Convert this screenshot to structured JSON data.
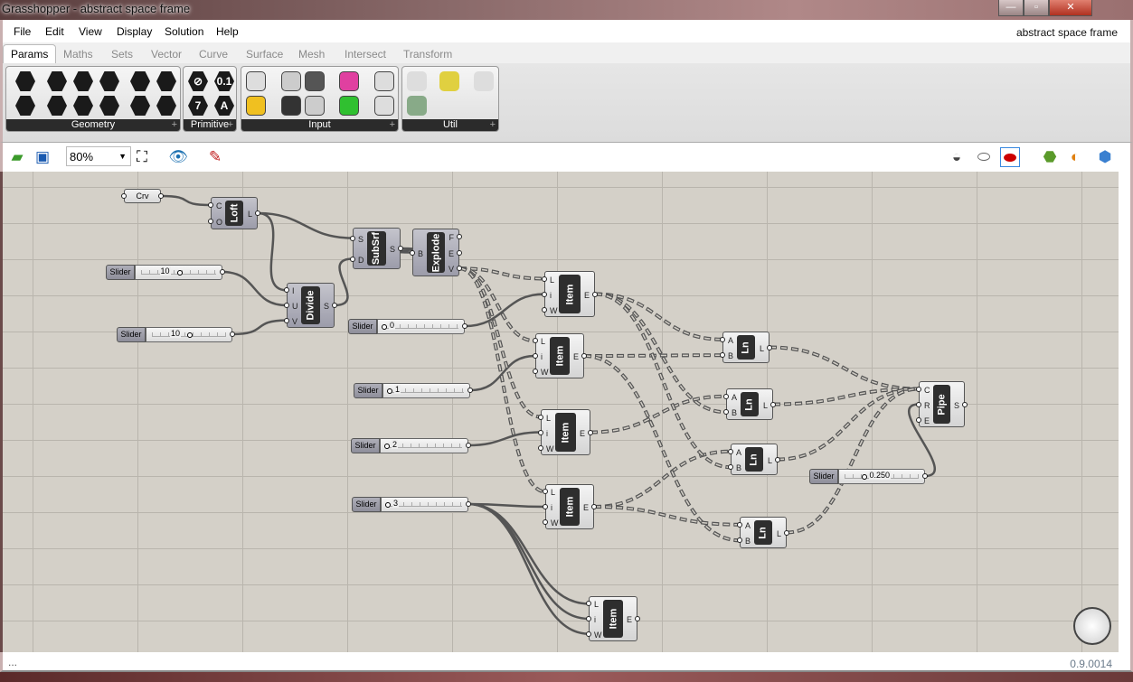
{
  "window": {
    "title": "Grasshopper - abstract space frame",
    "minimize": "—",
    "maximize": "▫",
    "close": "✕"
  },
  "menu": [
    "File",
    "Edit",
    "View",
    "Display",
    "Solution",
    "Help"
  ],
  "document_title": "abstract space frame",
  "tabs": [
    {
      "label": "Params",
      "active": true
    },
    {
      "label": "Maths"
    },
    {
      "label": "Sets"
    },
    {
      "label": "Vector"
    },
    {
      "label": "Curve"
    },
    {
      "label": "Surface"
    },
    {
      "label": "Mesh"
    },
    {
      "label": "Intersect"
    },
    {
      "label": "Transform"
    }
  ],
  "ribbon_groups": [
    {
      "label": "Geometry",
      "icons": [
        "point-icon",
        "circle-icon",
        "curve-icon",
        "surface-icon",
        "box-icon",
        "mesh-icon",
        "vector-icon",
        "arc-icon",
        "line-icon",
        "plane-icon",
        "brep-icon",
        "geometry-icon"
      ]
    },
    {
      "label": "Primitive",
      "icons": [
        "boolean-icon",
        "number-icon",
        "integer-icon",
        "text-icon"
      ]
    },
    {
      "label": "Input",
      "icons": [
        "panel-icon",
        "toggle-icon",
        "digit-scroller-icon",
        "gradient-icon",
        "graph-mapper-icon",
        "sketch-icon",
        "button-icon",
        "value-list-icon",
        "colour-swatch-icon",
        "read-file-icon"
      ]
    },
    {
      "label": "Util",
      "icons": [
        "cluster-icon",
        "data-recorder-icon",
        "preview-icon",
        "quick-graph-icon",
        "text-tag-icon",
        "chemistry-icon"
      ]
    }
  ],
  "ribbon_glyphs": {
    "Primitive": [
      "⊘",
      "0.1",
      "7",
      "A"
    ]
  },
  "canvas_toolbar": {
    "zoom": "80%"
  },
  "status": {
    "left": "...",
    "version": "0.9.0014"
  },
  "nodes": [
    {
      "id": "crv",
      "type": "param",
      "label": "Crv"
    },
    {
      "id": "loft",
      "label": "Loft",
      "inputs": [
        "C",
        "O"
      ],
      "outputs": [
        "L"
      ]
    },
    {
      "id": "divide",
      "label": "Divide",
      "inputs": [
        "I",
        "U",
        "V"
      ],
      "outputs": [
        "S"
      ]
    },
    {
      "id": "subsrf",
      "label": "SubSrf",
      "inputs": [
        "S",
        "D"
      ],
      "outputs": [
        "S"
      ]
    },
    {
      "id": "explode",
      "label": "Explode",
      "inputs": [
        "B"
      ],
      "outputs": [
        "F",
        "E",
        "V"
      ]
    },
    {
      "id": "item1",
      "label": "Item",
      "light": true,
      "inputs": [
        "L",
        "i",
        "W"
      ],
      "outputs": [
        "E"
      ]
    },
    {
      "id": "item2",
      "label": "Item",
      "light": true,
      "inputs": [
        "L",
        "i",
        "W"
      ],
      "outputs": [
        "E"
      ]
    },
    {
      "id": "item3",
      "label": "Item",
      "light": true,
      "inputs": [
        "L",
        "i",
        "W"
      ],
      "outputs": [
        "E"
      ]
    },
    {
      "id": "item4",
      "label": "Item",
      "light": true,
      "inputs": [
        "L",
        "i",
        "W"
      ],
      "outputs": [
        "E"
      ]
    },
    {
      "id": "item5",
      "label": "Item",
      "light": true,
      "inputs": [
        "L",
        "i",
        "W"
      ],
      "outputs": [
        "E"
      ]
    },
    {
      "id": "ln1",
      "label": "Ln",
      "light": true,
      "inputs": [
        "A",
        "B"
      ],
      "outputs": [
        "L"
      ]
    },
    {
      "id": "ln2",
      "label": "Ln",
      "light": true,
      "inputs": [
        "A",
        "B"
      ],
      "outputs": [
        "L"
      ]
    },
    {
      "id": "ln3",
      "label": "Ln",
      "light": true,
      "inputs": [
        "A",
        "B"
      ],
      "outputs": [
        "L"
      ]
    },
    {
      "id": "ln4",
      "label": "Ln",
      "light": true,
      "inputs": [
        "A",
        "B"
      ],
      "outputs": [
        "L"
      ]
    },
    {
      "id": "pipe",
      "label": "Pipe",
      "light": true,
      "inputs": [
        "C",
        "R",
        "E"
      ],
      "outputs": [
        "S"
      ]
    }
  ],
  "sliders": [
    {
      "id": "sU",
      "label": "Slider",
      "value": "10",
      "fraction": 0.5
    },
    {
      "id": "sV",
      "label": "Slider",
      "value": "10",
      "fraction": 0.5
    },
    {
      "id": "s0",
      "label": "Slider",
      "value": "0",
      "fraction": 0.0
    },
    {
      "id": "s1",
      "label": "Slider",
      "value": "1",
      "fraction": 0.0
    },
    {
      "id": "s2",
      "label": "Slider",
      "value": "2",
      "fraction": 0.0
    },
    {
      "id": "s3",
      "label": "Slider",
      "value": "3",
      "fraction": 0.0
    },
    {
      "id": "sR",
      "label": "Slider",
      "value": "0.250",
      "fraction": 0.25
    }
  ],
  "wires": [
    [
      "crv",
      0,
      "loft",
      0,
      "solid"
    ],
    [
      "loft",
      0,
      "subsrf",
      0,
      "solid"
    ],
    [
      "loft",
      0,
      "divide",
      0,
      "solid"
    ],
    [
      "sU",
      0,
      "divide",
      1,
      "solid"
    ],
    [
      "sV",
      0,
      "divide",
      2,
      "solid"
    ],
    [
      "divide",
      0,
      "subsrf",
      1,
      "solid"
    ],
    [
      "subsrf",
      0,
      "explode",
      0,
      "solid"
    ],
    [
      "s0",
      0,
      "item1",
      1,
      "solid"
    ],
    [
      "s1",
      0,
      "item2",
      1,
      "solid"
    ],
    [
      "s2",
      0,
      "item3",
      1,
      "solid"
    ],
    [
      "s3",
      0,
      "item4",
      1,
      "solid"
    ],
    [
      "s3",
      0,
      "item5",
      0,
      "solid"
    ],
    [
      "s3",
      0,
      "item5",
      1,
      "solid"
    ],
    [
      "s3",
      0,
      "item5",
      2,
      "solid"
    ],
    [
      "sR",
      0,
      "pipe",
      1,
      "solid"
    ],
    [
      "explode",
      2,
      "item1",
      0,
      "dash"
    ],
    [
      "explode",
      2,
      "item2",
      0,
      "dash"
    ],
    [
      "explode",
      2,
      "item3",
      0,
      "dash"
    ],
    [
      "explode",
      2,
      "item4",
      0,
      "dash"
    ],
    [
      "item1",
      0,
      "ln1",
      0,
      "dash"
    ],
    [
      "item2",
      0,
      "ln1",
      1,
      "dash"
    ],
    [
      "item1",
      0,
      "ln2",
      1,
      "dash"
    ],
    [
      "item3",
      0,
      "ln2",
      0,
      "dash"
    ],
    [
      "item4",
      0,
      "ln3",
      0,
      "dash"
    ],
    [
      "item2",
      0,
      "ln4",
      1,
      "dash"
    ],
    [
      "item1",
      0,
      "ln3",
      1,
      "dash"
    ],
    [
      "item4",
      0,
      "ln4",
      0,
      "dash"
    ],
    [
      "ln1",
      0,
      "pipe",
      0,
      "dash"
    ],
    [
      "ln2",
      0,
      "pipe",
      0,
      "dash"
    ],
    [
      "ln3",
      0,
      "pipe",
      0,
      "dash"
    ],
    [
      "ln4",
      0,
      "pipe",
      0,
      "dash"
    ]
  ]
}
